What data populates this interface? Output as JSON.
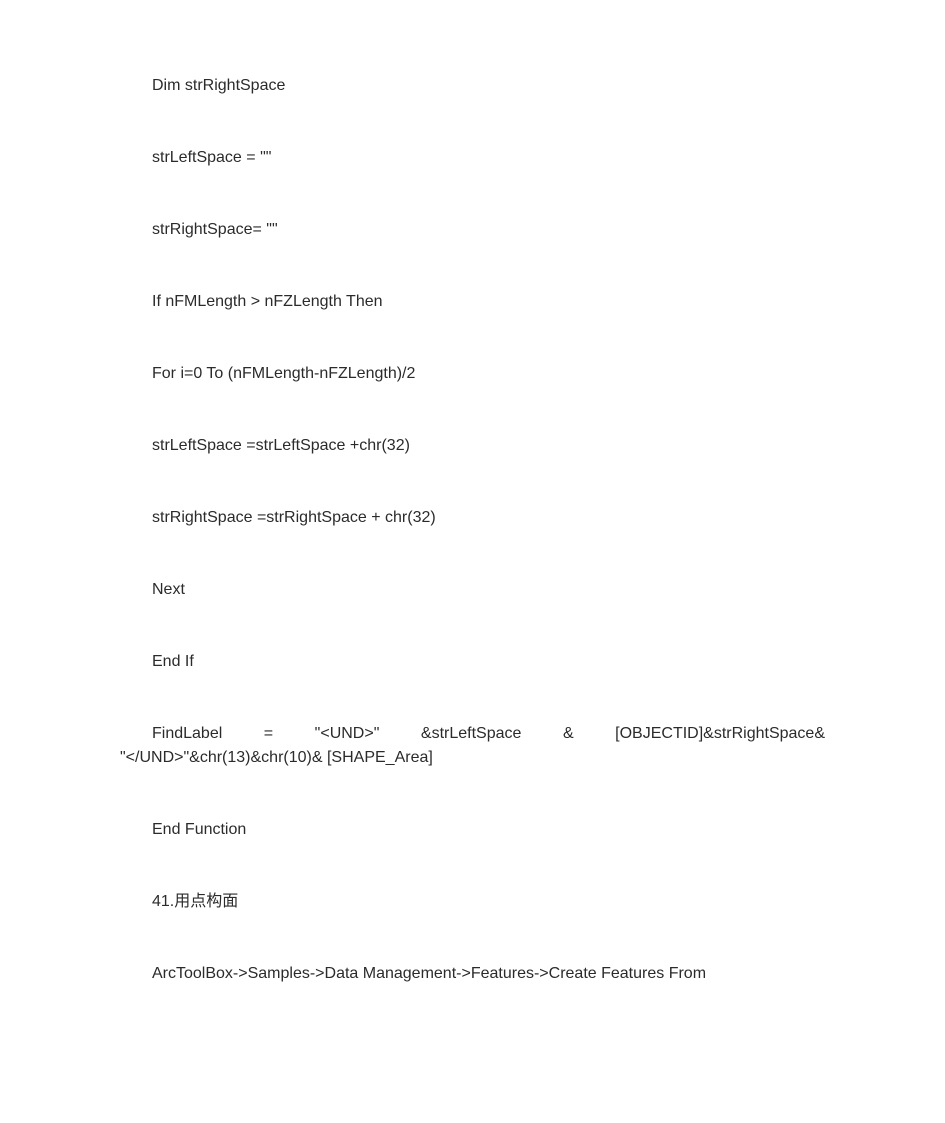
{
  "lines": {
    "l1": "Dim strRightSpace",
    "l2": "strLeftSpace     = \"\"",
    "l3": "strRightSpace= \"\"",
    "l4": "If nFMLength > nFZLength Then",
    "l5": "For i=0 To     (nFMLength-nFZLength)/2",
    "l6": "strLeftSpace =strLeftSpace +chr(32)",
    "l7": "strRightSpace =strRightSpace + chr(32)",
    "l8": "Next",
    "l9": "End If",
    "l10a": "FindLabel   =   \"<UND>\"      &strLeftSpace   &   [OBJECTID]&strRightSpace&",
    "l10b": "\"</UND>\"&chr(13)&chr(10)&     [SHAPE_Area]",
    "l11": "End Function",
    "l12": "41.用点构面",
    "l13": "ArcToolBox->Samples->Data Management->Features->Create Features From"
  }
}
